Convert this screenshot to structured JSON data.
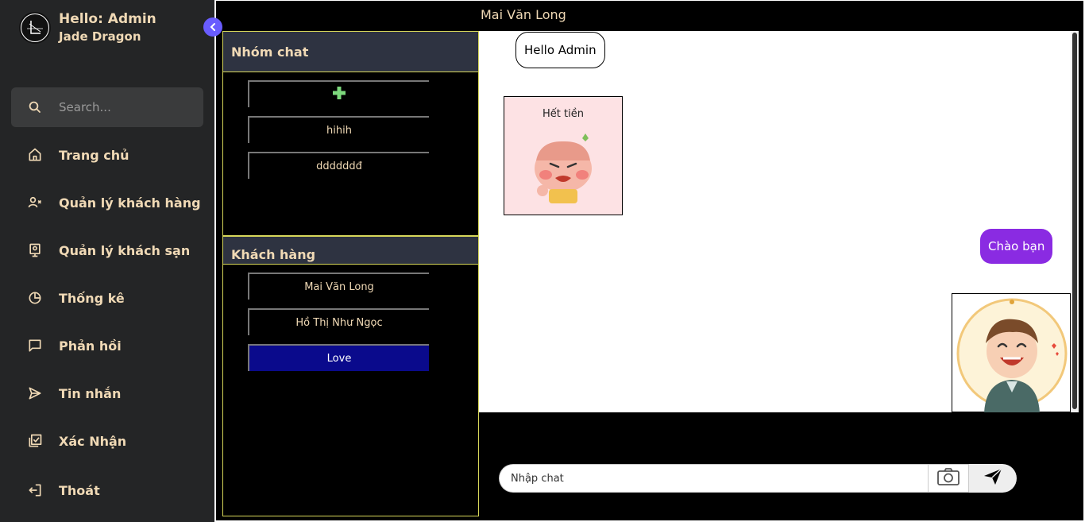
{
  "sidebar": {
    "greeting": "Hello: Admin",
    "subtitle": "Jade Dragon",
    "search_placeholder": "Search...",
    "items": [
      {
        "label": "Trang chủ",
        "icon": "home-icon"
      },
      {
        "label": "Quản lý khách hàng",
        "icon": "user-x-icon"
      },
      {
        "label": "Quản lý khách sạn",
        "icon": "hotel-icon"
      },
      {
        "label": "Thống kê",
        "icon": "pie-chart-icon"
      },
      {
        "label": "Phản hồi",
        "icon": "message-square-icon"
      },
      {
        "label": "Tin nhắn",
        "icon": "send-icon"
      },
      {
        "label": "Xác Nhận",
        "icon": "checklist-icon"
      }
    ],
    "logout_label": "Thoát"
  },
  "chat": {
    "header": "Mai Văn Long",
    "groups_title": "Nhóm chat",
    "groups": [
      "hihih",
      "ddddddđ"
    ],
    "customers_title": "Khách hàng",
    "customers": [
      "Mai Văn Long",
      "Hồ Thị Như Ngọc",
      "Love"
    ],
    "active_customer": "Love",
    "messages": {
      "incoming_text": "Hello Admin",
      "incoming_sticker_caption": "Hết tiền",
      "outgoing_text": "Chào bạn"
    },
    "input_placeholder": "Nhập chat"
  },
  "colors": {
    "accent": "#695cfe",
    "sidebar_bg": "#242526",
    "text": "#f0d9b5",
    "outgoing_bubble": "#8a2be2",
    "active_item": "#0a0a8c"
  }
}
